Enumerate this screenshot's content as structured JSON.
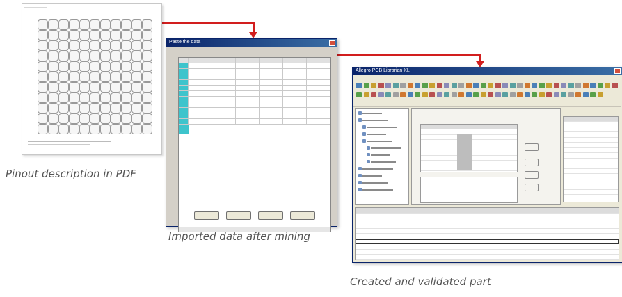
{
  "captions": {
    "pdf": "Pinout description in PDF",
    "imported": "Imported data after mining",
    "created": "Created and validated part"
  },
  "colors": {
    "arrow": "#d21e1e",
    "teal_column": "#3ec4cc",
    "title_bar": "#0a246a"
  },
  "pdf_page": {
    "grid_rows": 11,
    "grid_cols": 11
  },
  "paste_dialog": {
    "title": "Paste the data"
  },
  "app_window": {
    "title": "Allegro PCB Librarian XL"
  }
}
